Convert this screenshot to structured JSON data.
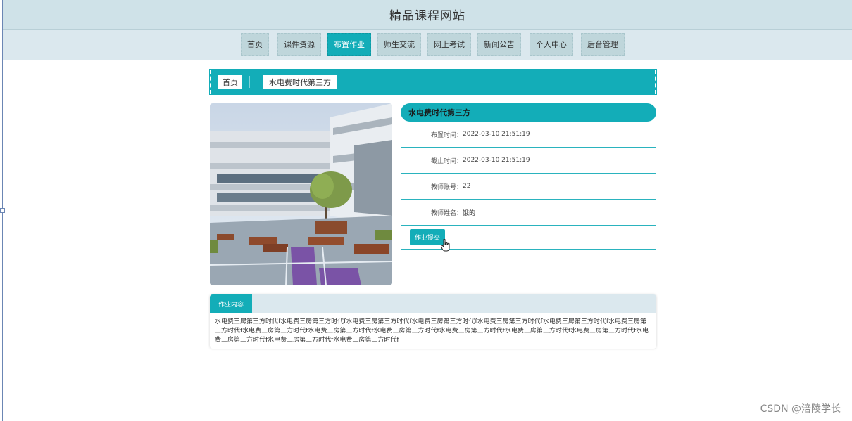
{
  "header": {
    "title": "精品课程网站"
  },
  "nav": {
    "items": [
      {
        "label": "首页",
        "active": false
      },
      {
        "label": "课件资源",
        "active": false
      },
      {
        "label": "布置作业",
        "active": true
      },
      {
        "label": "师生交流",
        "active": false
      },
      {
        "label": "网上考试",
        "active": false
      },
      {
        "label": "新闻公告",
        "active": false
      },
      {
        "label": "个人中心",
        "active": false
      },
      {
        "label": "后台管理",
        "active": false
      }
    ]
  },
  "breadcrumb": {
    "home": "首页",
    "current": "水电费时代第三方"
  },
  "detail": {
    "title": "水电费时代第三方",
    "rows": [
      {
        "label": "布置时间：",
        "value": "2022-03-10 21:51:19"
      },
      {
        "label": "截止时间：",
        "value": "2022-03-10 21:51:19"
      },
      {
        "label": "教师账号：",
        "value": "22"
      },
      {
        "label": "教师姓名：",
        "value": "饿的"
      }
    ],
    "submit_label": "作业提交"
  },
  "content": {
    "tab_label": "作业内容",
    "text": "水电费三房第三方时代f水电费三房第三方时代f水电费三房第三方时代f水电费三房第三方时代f水电费三房第三方时代f水电费三房第三方时代f水电费三房第三方时代f水电费三房第三方时代f水电费三房第三方时代f水电费三房第三方时代f水电费三房第三方时代f水电费三房第三方时代f水电费三房第三方时代f水电费三房第三方时代f水电费三房第三方时代f水电费三房第三方时代f"
  },
  "watermark": "CSDN @涪陵学长",
  "colors": {
    "accent": "#13adb8",
    "header_bg": "#cfe2e8",
    "nav_bg": "#dbe8ee"
  }
}
